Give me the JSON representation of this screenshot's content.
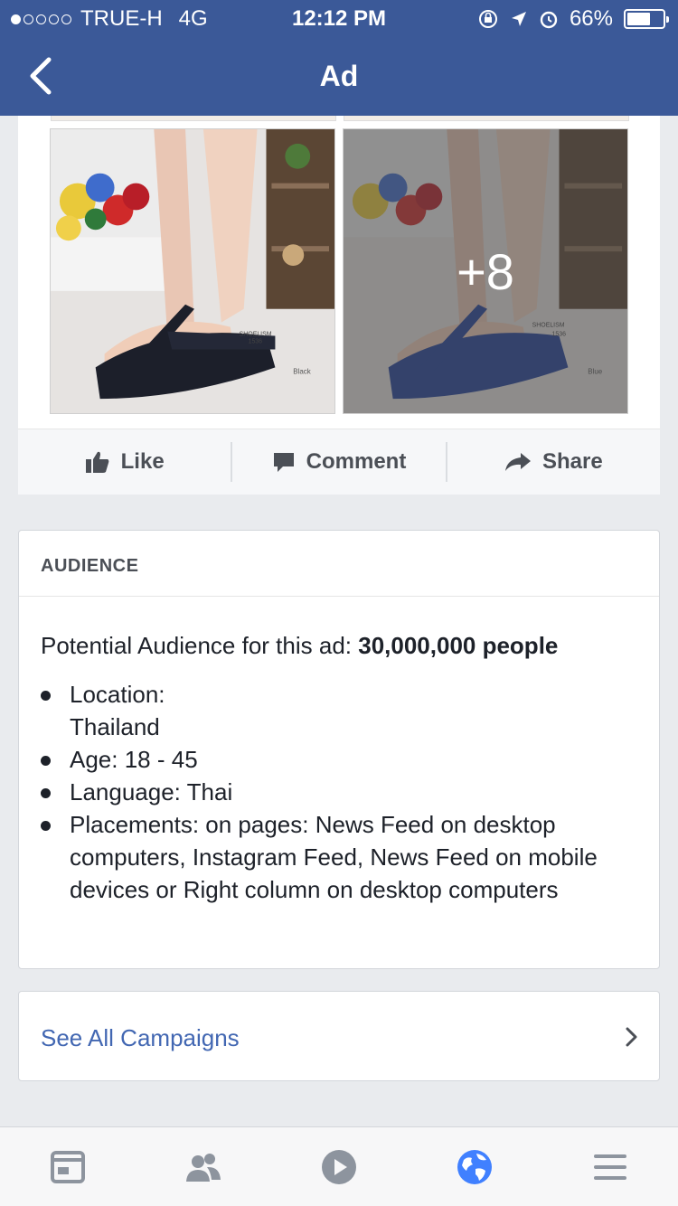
{
  "status_bar": {
    "carrier": "TRUE-H",
    "network": "4G",
    "time": "12:12 PM",
    "battery_pct": "66%",
    "battery_level": 0.66,
    "signal_bars_filled": 1
  },
  "nav": {
    "title": "Ad",
    "back_icon": "back-chevron-icon"
  },
  "post": {
    "photos": [
      {
        "label": "Black",
        "code": "1536",
        "brand": "SHOELISM"
      },
      {
        "label": "Blue",
        "code": "1536",
        "brand": "SHOELISM",
        "more_count": "+8"
      }
    ],
    "actions": [
      {
        "label": "Like",
        "icon": "like-icon"
      },
      {
        "label": "Comment",
        "icon": "comment-icon"
      },
      {
        "label": "Share",
        "icon": "share-icon"
      }
    ]
  },
  "audience": {
    "header": "AUDIENCE",
    "potential_prefix": "Potential Audience for this ad: ",
    "potential_value": "30,000,000 people",
    "items": [
      {
        "line1": "Location:",
        "line2": "Thailand"
      },
      {
        "line1": "Age: 18 - 45"
      },
      {
        "line1": "Language: Thai"
      },
      {
        "line1": "Placements: on pages: News Feed on desktop computers, Instagram Feed, News Feed on mobile devices or Right column on desktop computers"
      }
    ]
  },
  "campaigns": {
    "label": "See All Campaigns"
  },
  "tabbar": {
    "tabs": [
      {
        "name": "news-feed",
        "icon": "news-feed-icon",
        "active": false
      },
      {
        "name": "friends",
        "icon": "friends-icon",
        "active": false
      },
      {
        "name": "video",
        "icon": "video-icon",
        "active": false
      },
      {
        "name": "notifications",
        "icon": "globe-icon",
        "active": true
      },
      {
        "name": "menu",
        "icon": "menu-icon",
        "active": false
      }
    ]
  },
  "colors": {
    "brand": "#3b5998",
    "link": "#4267b2",
    "active_tab": "#4080ff"
  }
}
